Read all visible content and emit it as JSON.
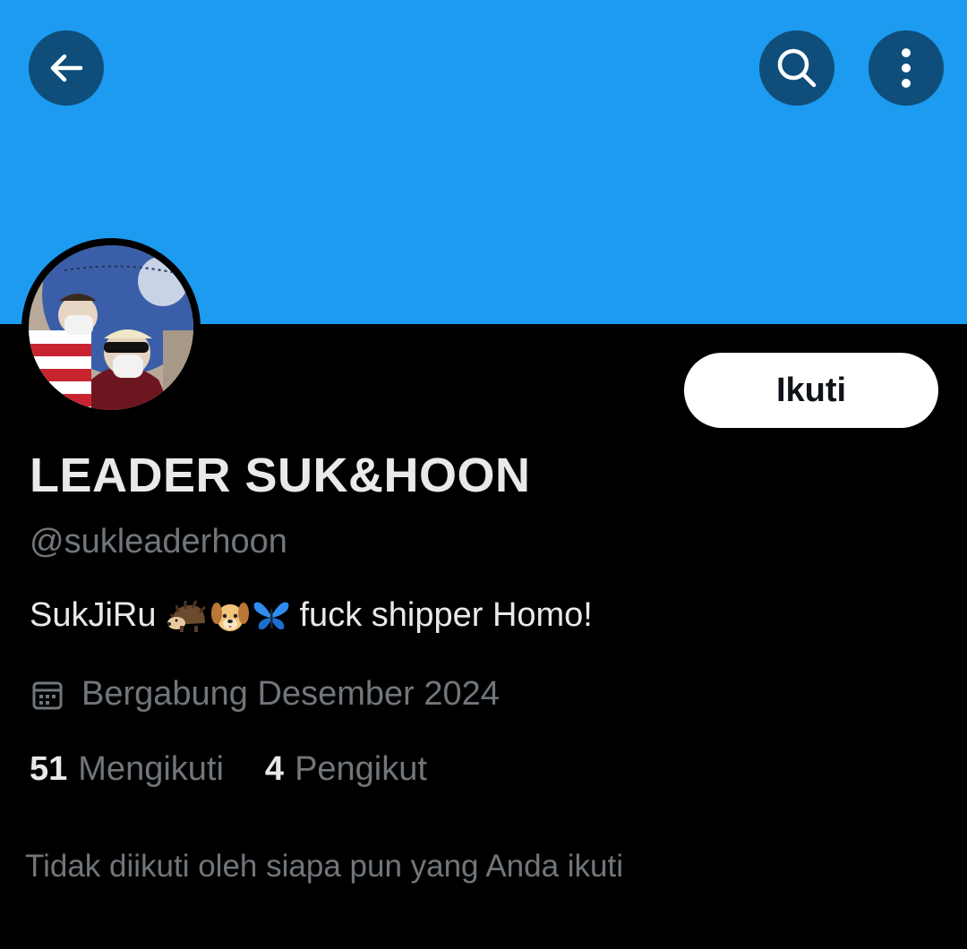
{
  "header": {
    "back_icon": "arrow-left-icon",
    "search_icon": "search-icon",
    "more_icon": "more-vertical-icon",
    "banner_color": "#1d9bf0",
    "button_bg": "#0f4e7a"
  },
  "profile": {
    "display_name": "LEADER SUK&HOON",
    "handle": "@sukleaderhoon",
    "bio_text_before": "SukJiRu",
    "bio_emojis": [
      "hedgehog-emoji",
      "dog-face-emoji",
      "butterfly-emoji"
    ],
    "bio_text_after": "fuck shipper Homo!",
    "joined_icon": "calendar-icon",
    "joined": "Bergabung Desember 2024",
    "following_count": "51",
    "following_label": "Mengikuti",
    "followers_count": "4",
    "followers_label": "Pengikut",
    "followed_by_text": "Tidak diikuti oleh siapa pun yang Anda ikuti"
  },
  "actions": {
    "follow_label": "Ikuti"
  },
  "colors": {
    "background": "#000000",
    "primary_text": "#e7e9ea",
    "secondary_text": "#71767b",
    "follow_button_bg": "#ffffff",
    "follow_button_text": "#0f1419"
  }
}
